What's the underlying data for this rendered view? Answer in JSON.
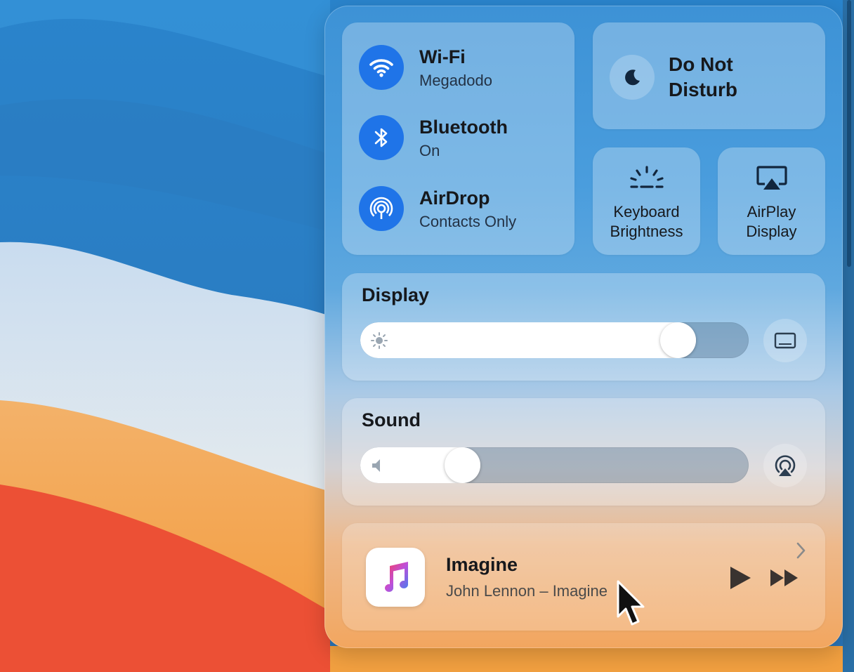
{
  "network": {
    "wifi": {
      "title": "Wi-Fi",
      "subtitle": "Megadodo",
      "icon": "wifi-icon"
    },
    "bluetooth": {
      "title": "Bluetooth",
      "subtitle": "On",
      "icon": "bluetooth-icon"
    },
    "airdrop": {
      "title": "AirDrop",
      "subtitle": "Contacts Only",
      "icon": "airdrop-icon"
    }
  },
  "do_not_disturb": {
    "line1": "Do Not",
    "line2": "Disturb",
    "icon": "moon-icon"
  },
  "keyboard_brightness": {
    "line1": "Keyboard",
    "line2": "Brightness",
    "icon": "keyboard-brightness-icon"
  },
  "airplay_display": {
    "line1": "AirPlay",
    "line2": "Display",
    "icon": "airplay-display-icon"
  },
  "display": {
    "title": "Display",
    "level": 0.85,
    "icon": "sun-icon",
    "side_icon": "display-icon"
  },
  "sound": {
    "title": "Sound",
    "level": 0.24,
    "icon": "speaker-icon",
    "side_icon": "airplay-audio-icon"
  },
  "now_playing": {
    "song": "Imagine",
    "artist": "John Lennon – Imagine",
    "app_icon": "music-note-icon"
  },
  "colors": {
    "accent": "#1f74e8",
    "panel_top": "#3d92d6",
    "panel_bottom": "#f2a65f"
  }
}
